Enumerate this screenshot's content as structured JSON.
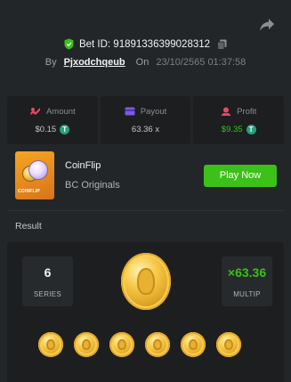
{
  "header": {
    "bet_id_label": "Bet ID: 91891336399028312",
    "by_label": "By",
    "username": "Pjxodchqeub",
    "on_label": "On",
    "datetime": "23/10/2565 01:37:58"
  },
  "stats": [
    {
      "label": "Amount",
      "value": "$0.15",
      "icon": "amount-icon",
      "currency": "T",
      "value_color": "#c4c6ca"
    },
    {
      "label": "Payout",
      "value": "63.36 x",
      "icon": "payout-icon",
      "value_color": "#c4c6ca"
    },
    {
      "label": "Profit",
      "value": "$9.35",
      "icon": "profit-icon",
      "currency": "T",
      "value_color": "#3bc117"
    }
  ],
  "game": {
    "thumb_label": "COINFLIP",
    "name": "CoinFlip",
    "provider": "BC Originals",
    "play_label": "Play Now"
  },
  "result": {
    "title": "Result",
    "series_value": "6",
    "series_caption": "SERIES",
    "multiplier_value": "×63.36",
    "multiplier_caption": "MULTIP",
    "coins": [
      "coin",
      "coin",
      "coin",
      "coin",
      "coin",
      "coin"
    ]
  },
  "colors": {
    "accent_green": "#3bc117",
    "background": "#232628",
    "panel": "#1c1e20"
  }
}
